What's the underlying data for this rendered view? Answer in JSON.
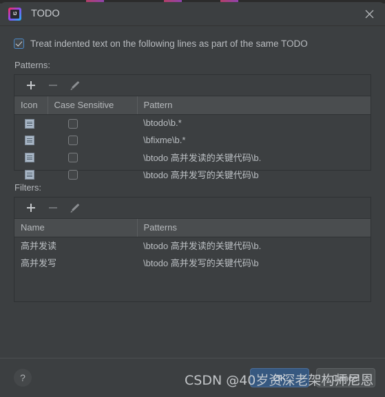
{
  "window": {
    "title": "TODO",
    "app_icon": "intellij-idea-icon",
    "close_icon": "close-icon"
  },
  "options": {
    "treat_indented": {
      "label": "Treat indented text on the following lines as part of the same TODO",
      "checked": true
    }
  },
  "patterns": {
    "section_label": "Patterns:",
    "toolbar": {
      "add_icon": "plus-icon",
      "remove_icon": "minus-icon",
      "edit_icon": "pencil-icon"
    },
    "columns": [
      "Icon",
      "Case Sensitive",
      "Pattern"
    ],
    "rows": [
      {
        "icon": "note-icon",
        "case_sensitive": false,
        "pattern": "\\btodo\\b.*"
      },
      {
        "icon": "note-icon",
        "case_sensitive": false,
        "pattern": "\\bfixme\\b.*"
      },
      {
        "icon": "note-icon",
        "case_sensitive": false,
        "pattern": "\\btodo 高并发读的关键代码\\b."
      },
      {
        "icon": "note-icon",
        "case_sensitive": false,
        "pattern": "\\btodo 高并发写的关键代码\\b"
      }
    ]
  },
  "filters": {
    "section_label": "Filters:",
    "toolbar": {
      "add_icon": "plus-icon",
      "remove_icon": "minus-icon",
      "edit_icon": "pencil-icon"
    },
    "columns": [
      "Name",
      "Patterns"
    ],
    "rows": [
      {
        "name": "高并发读",
        "patterns": "\\btodo 高并发读的关键代码\\b."
      },
      {
        "name": "高并发写",
        "patterns": "\\btodo 高并发写的关键代码\\b"
      }
    ]
  },
  "footer": {
    "help_label": "?",
    "ok_label": "OK",
    "cancel_label": "Cancel"
  },
  "watermark": {
    "text": "CSDN @40岁资深老架构师尼恩"
  },
  "colors": {
    "dialog_bg": "#3c3f41",
    "header_bg": "#4a4d4f",
    "accent": "#365880",
    "checkbox_accent": "#4a88c7",
    "note_icon": "#a9b7c6"
  }
}
